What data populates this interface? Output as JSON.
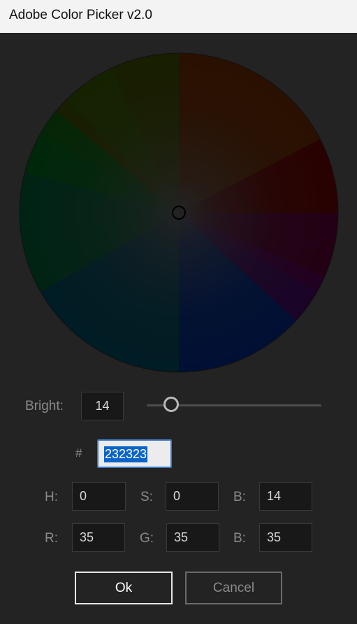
{
  "window": {
    "title": "Adobe Color Picker v2.0"
  },
  "brightness": {
    "label": "Bright:",
    "value": "14",
    "slider_fraction": 0.14
  },
  "hex": {
    "label": "#",
    "value": "232323"
  },
  "hsb": {
    "h_label": "H:",
    "h_value": "0",
    "s_label": "S:",
    "s_value": "0",
    "b_label": "B:",
    "b_value": "14"
  },
  "rgb": {
    "r_label": "R:",
    "r_value": "35",
    "g_label": "G:",
    "g_value": "35",
    "b_label": "B:",
    "b_value": "35"
  },
  "buttons": {
    "ok_label": "Ok",
    "cancel_label": "Cancel"
  },
  "colors": {
    "background": "#232323",
    "selected": "#232323",
    "selection_highlight": "#0a64c8",
    "focus_border": "#3a78c8"
  }
}
